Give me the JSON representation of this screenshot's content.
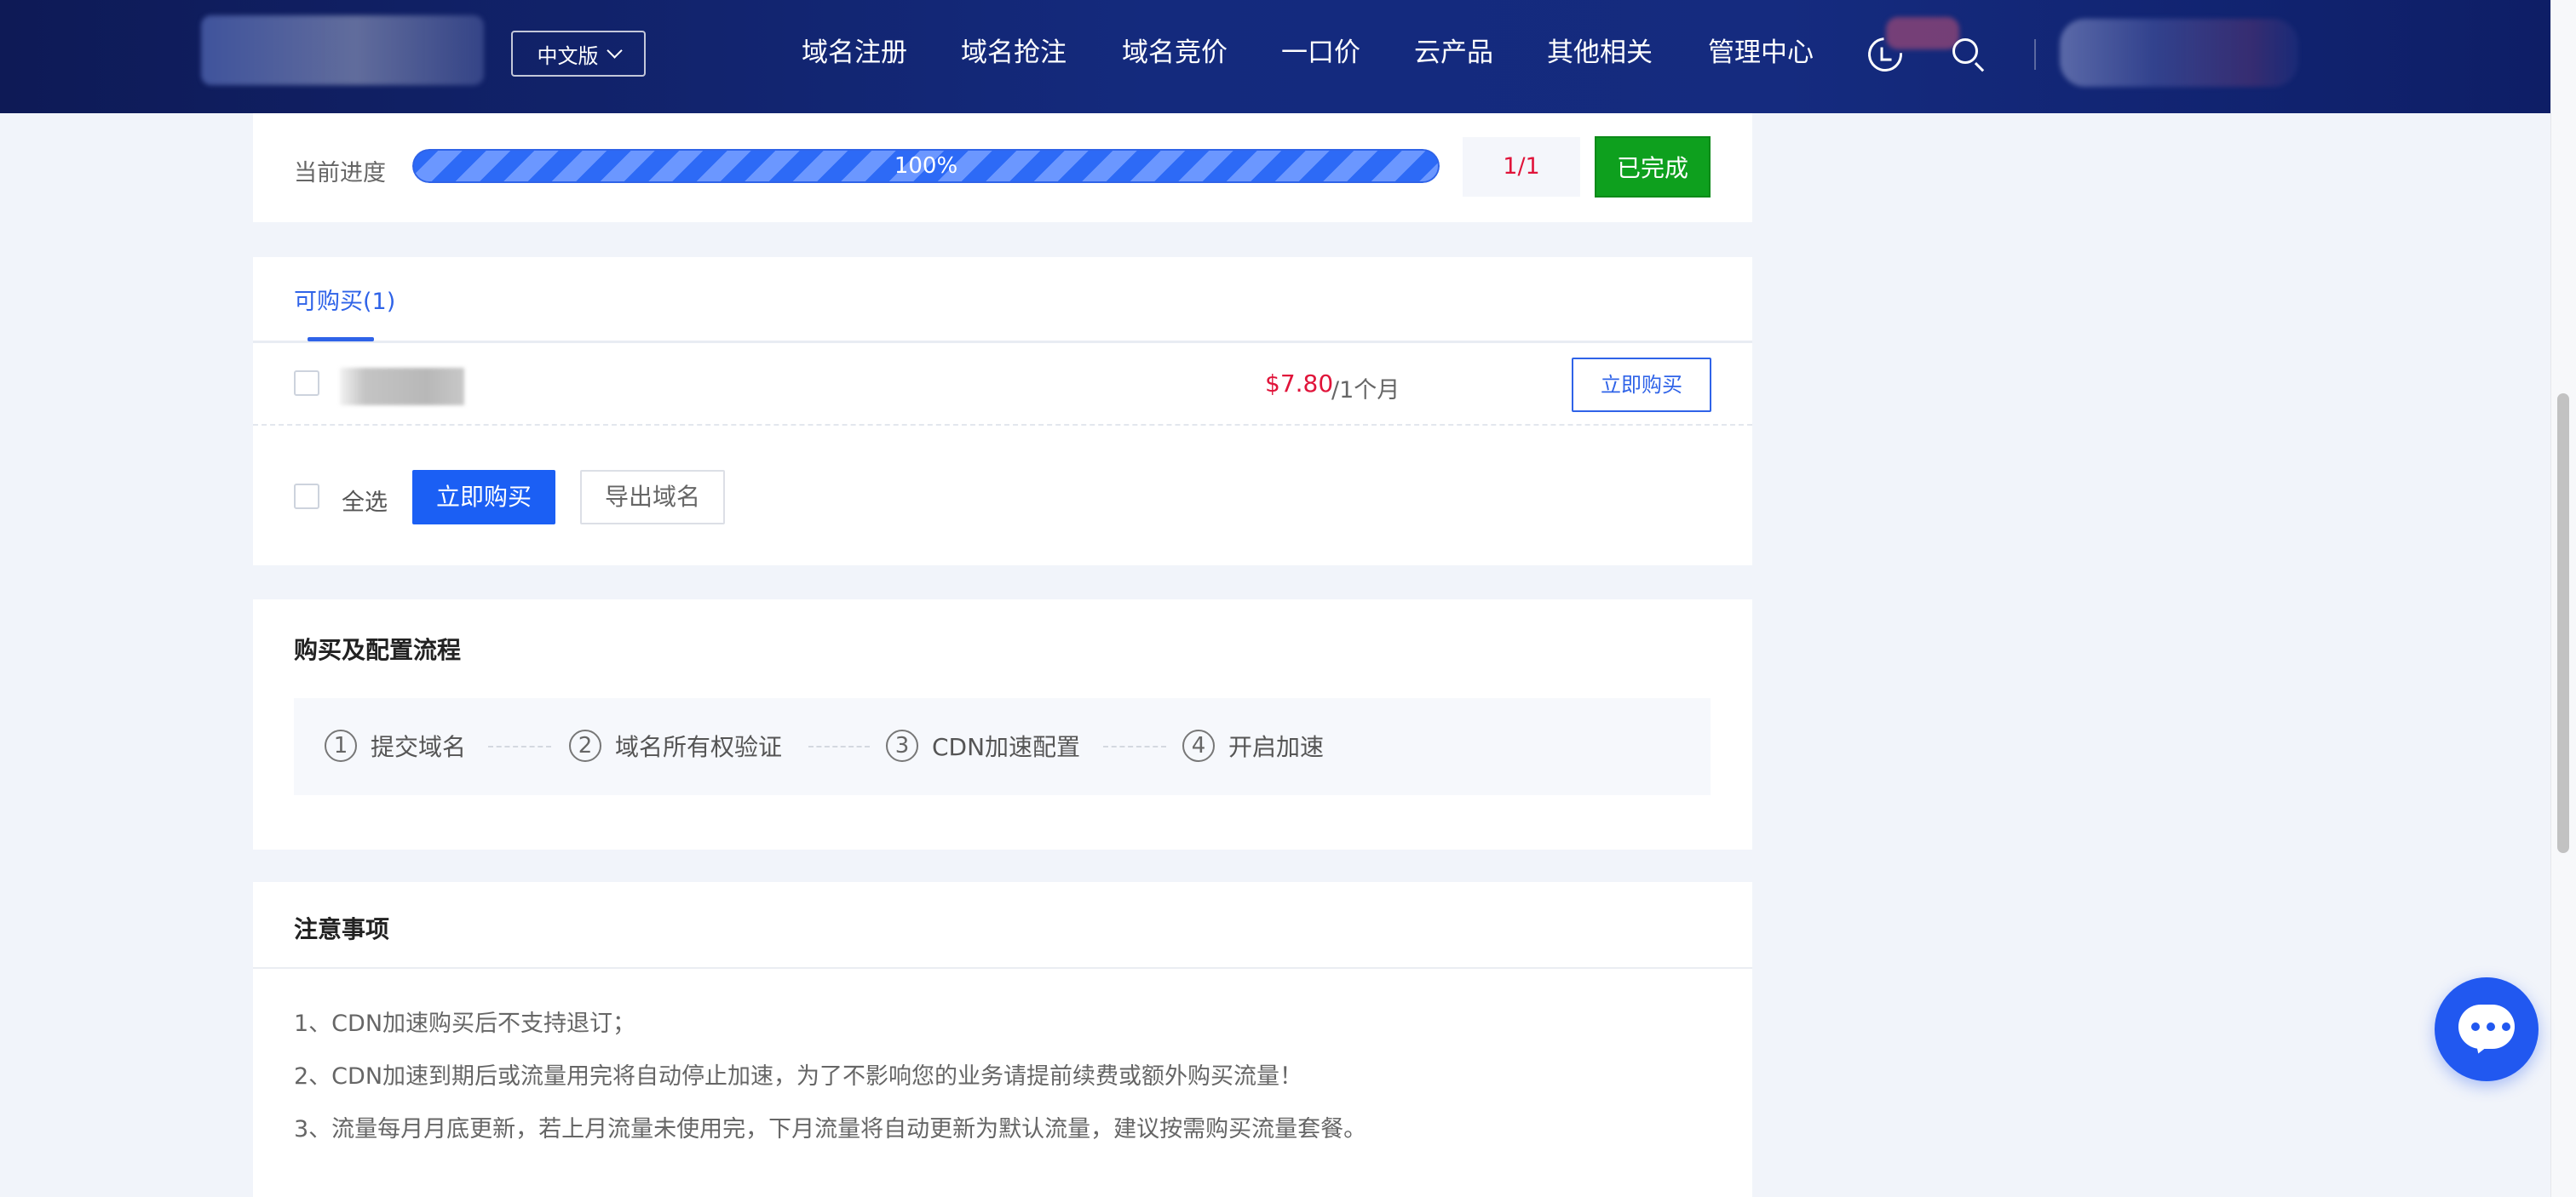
{
  "header": {
    "language_button": "中文版",
    "nav": [
      "域名注册",
      "域名抢注",
      "域名竞价",
      "一口价",
      "云产品",
      "其他相关",
      "管理中心"
    ],
    "icons": [
      "history-icon",
      "search-icon"
    ]
  },
  "progress": {
    "label": "当前进度",
    "percent": 100,
    "percent_text": "100%",
    "count": "1/1",
    "status": "已完成"
  },
  "purchase": {
    "tab_label": "可购买(1)",
    "items": [
      {
        "price": "$7.80",
        "period": " /1个月",
        "action": "立即购买"
      }
    ],
    "select_all": "全选",
    "buy_now": "立即购买",
    "export": "导出域名"
  },
  "flow": {
    "title": "购买及配置流程",
    "steps": [
      {
        "num": "1",
        "label": "提交域名"
      },
      {
        "num": "2",
        "label": "域名所有权验证"
      },
      {
        "num": "3",
        "label": "CDN加速配置"
      },
      {
        "num": "4",
        "label": "开启加速"
      }
    ]
  },
  "notes": {
    "title": "注意事项",
    "items": [
      "1、CDN加速购买后不支持退订；",
      "2、CDN加速到期后或流量用完将自动停止加速，为了不影响您的业务请提前续费或额外购买流量！",
      "3、流量每月月底更新，若上月流量未使用完，下月流量将自动更新为默认流量，建议按需购买流量套餐。"
    ]
  },
  "colors": {
    "header": "#142a7d",
    "accent": "#2f63e8",
    "price": "#e0143a",
    "success": "#0ea01e"
  }
}
